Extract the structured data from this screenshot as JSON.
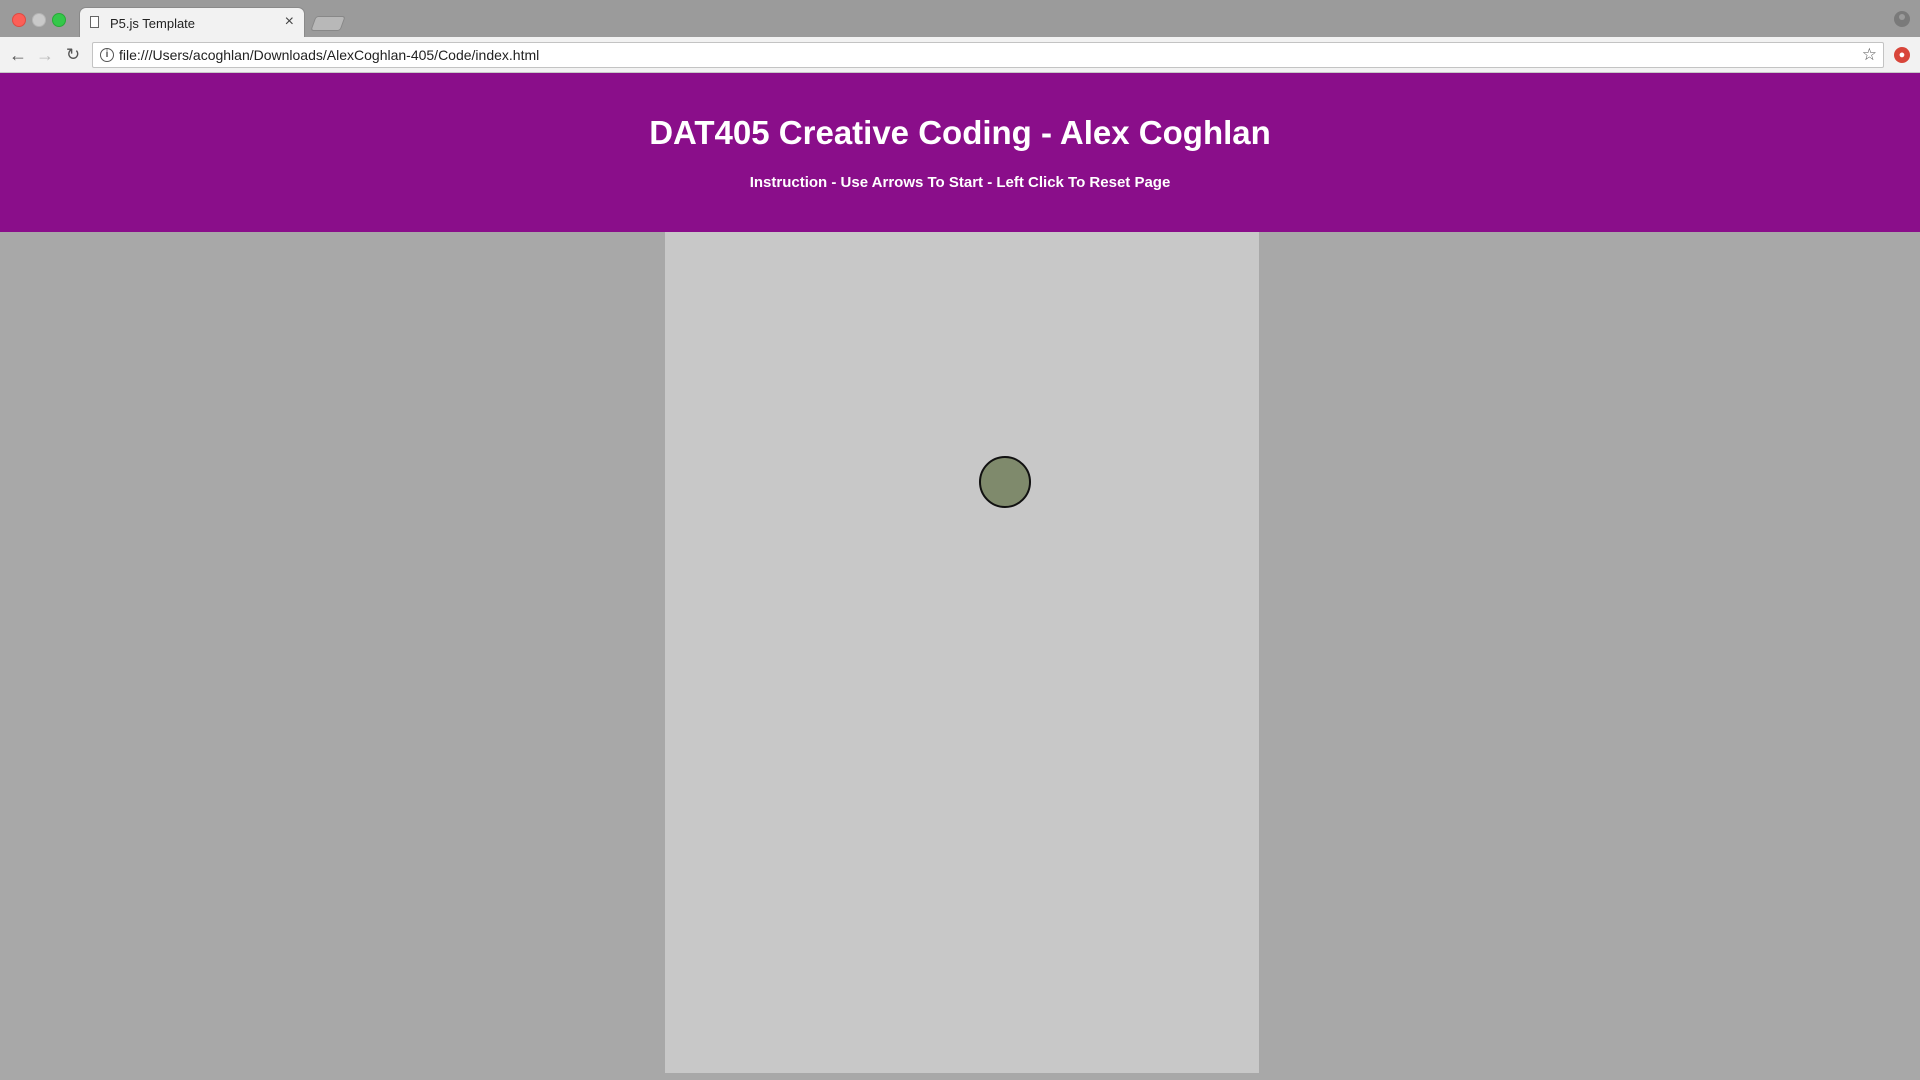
{
  "browser": {
    "tab": {
      "title": "P5.js Template",
      "close_glyph": "×"
    },
    "nav": {
      "back_glyph": "←",
      "forward_glyph": "→",
      "reload_glyph": "↻"
    },
    "address": {
      "url": "file:///Users/acoghlan/Downloads/AlexCoghlan-405/Code/index.html",
      "info_glyph": "i",
      "star_glyph": "☆"
    },
    "icons": [
      "document-icon",
      "info-icon",
      "star-icon",
      "extension-icon",
      "profile-icon"
    ]
  },
  "page": {
    "title": "DAT405 Creative Coding - Alex Coghlan",
    "instruction": "Instruction - Use Arrows To Start - Left Click To Reset Page"
  },
  "sketch": {
    "ball_color": "#7f8a6c"
  },
  "colors": {
    "header_bg": "#8a0e8a",
    "page_bg": "#a8a8a8",
    "canvas_bg": "#c8c8c8"
  }
}
